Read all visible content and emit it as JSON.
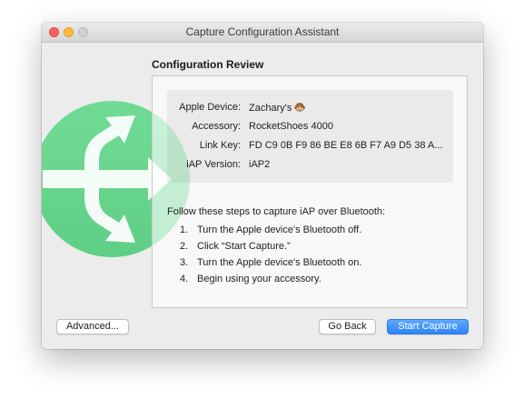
{
  "window": {
    "title": "Capture Configuration Assistant"
  },
  "section": {
    "heading": "Configuration Review"
  },
  "device_info": [
    {
      "label": "Apple Device:",
      "value": "Zachary's"
    },
    {
      "label": "Accessory:",
      "value": "RocketShoes 4000"
    },
    {
      "label": "Link Key:",
      "value": "FD C9 0B F9 86 BE E8 6B F7 A9 D5 38 A..."
    },
    {
      "label": "iAP Version:",
      "value": "iAP2"
    }
  ],
  "device_emoji_icon": "monkey-face-icon",
  "instructions": {
    "intro": "Follow these steps to capture iAP over Bluetooth:",
    "steps": [
      {
        "num": "1.",
        "text": "Turn the Apple device's Bluetooth off."
      },
      {
        "num": "2.",
        "text": "Click “Start Capture.”"
      },
      {
        "num": "3.",
        "text": "Turn the Apple device's Bluetooth on."
      },
      {
        "num": "4.",
        "text": "Begin using your accessory."
      }
    ]
  },
  "buttons": {
    "advanced": "Advanced...",
    "go_back": "Go Back",
    "start_capture": "Start Capture"
  },
  "colors": {
    "accent": "#2e86f7",
    "logo_green": "#6ed891"
  }
}
